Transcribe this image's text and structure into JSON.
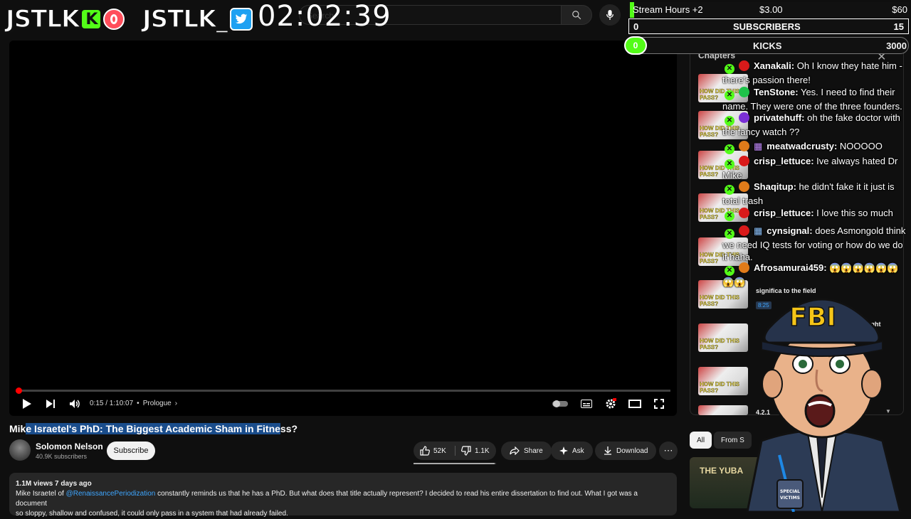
{
  "overlay": {
    "brand1": "JSTLK",
    "brand1_badge": "K",
    "brand2": "JSTLK_",
    "clock": "02:02:39"
  },
  "stats": {
    "stream_hours_label": "Stream Hours +2",
    "stream_hours_amount": "$3.00",
    "stream_hours_goal": "$60",
    "subs_current": "0",
    "subs_label": "SUBSCRIBERS",
    "subs_goal": "15",
    "kicks_current": "0",
    "kicks_label": "KICKS",
    "kicks_goal": "3000"
  },
  "search": {
    "placeholder": "Search"
  },
  "player": {
    "progress": 0.0036,
    "time": "0:15 / 1:10:07",
    "chapter": "Prologue",
    "chapter_sep": "•"
  },
  "video": {
    "title_pre": "Mik",
    "title_highlight": "e Israetel's PhD: The Biggest Academic Sham in Fitne",
    "title_post": "ss?",
    "channel": "Solomon Nelson",
    "subscribers": "40.9K subscribers",
    "subscribe_label": "Subscribe",
    "likes": "52K",
    "dislikes": "1.1K",
    "share_label": "Share",
    "ask_label": "Ask",
    "download_label": "Download",
    "more_label": "⋯"
  },
  "description": {
    "meta": "1.1M views  7 days ago",
    "text_1": "Mike Israetel of ",
    "link": "@RenaissancePeriodization",
    "text_2": " constantly reminds us that he has a PhD. But what does that title actually represent? I decided to read his entire dissertation to find out. What I got was a document",
    "text_3": "so sloppy, shallow and confused, it could only pass in a system that had already failed."
  },
  "side": {
    "title": "Chapters",
    "thumb_caption": "HOW DID THIS PASS?",
    "chapter_fragment_1": "significa        to the field",
    "chapter_time_1": "8:25",
    "chapter_fragment_2": "hought",
    "chapter_fragment_3": "4.2.1",
    "chip_all": "All",
    "chip_from": "From S",
    "rec_title": "THE YUBA"
  },
  "chat": [
    {
      "user": "Xanakali:",
      "text": " Oh I know they hate him - there's passion there!",
      "color": "#d91a1a"
    },
    {
      "user": "TenStone:",
      "text": " Yes. I need to find their name. They were one of the three founders.",
      "color": "#1ec24a"
    },
    {
      "user": "privatehuff:",
      "text": " oh the fake doctor with the fancy watch ??",
      "color": "#7a2fd6"
    },
    {
      "user": "meatwadcrusty:",
      "text": " NOOOOO",
      "color": "#e07b1a"
    },
    {
      "user": "crisp_lettuce:",
      "text": " Ive always hated Dr Mike",
      "color": "#d91a1a"
    },
    {
      "user": "Shaqitup:",
      "text": " he didn't fake it it just is total trash",
      "color": "#e07b1a"
    },
    {
      "user": "crisp_lettuce:",
      "text": " I love this so much",
      "color": "#d91a1a"
    },
    {
      "user": "cynsignal:",
      "text": " does Asmongold think we need IQ tests for voting or how do we do it haha.",
      "color": "#d91a1a"
    },
    {
      "user": "Afrosamurai459:",
      "text": " 😱😱😱😱😱😱😱😱",
      "color": "#e07b1a"
    }
  ],
  "character": {
    "hat_text": "FBI",
    "badge_text": "SPECIAL VICTIMS"
  }
}
